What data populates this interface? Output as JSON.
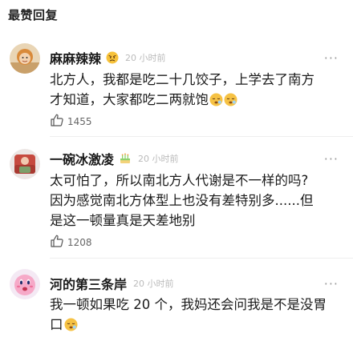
{
  "section": {
    "title": "最赞回复"
  },
  "comments": [
    {
      "username": "麻麻辣辣",
      "time": "20 小时前",
      "line1": "北方人，我都是吃二十几饺子，上学去了南方",
      "line2": "才知道，大家都吃二两就饱",
      "likes": "1455",
      "badge_icon": "angry-face-emoji",
      "trailing_emojis": [
        "sleepy-face-emoji",
        "sleepy-face-emoji"
      ]
    },
    {
      "username": "一碗冰激凌",
      "time": "20 小时前",
      "line1": "太可怕了，所以南北方人代谢是不一样的吗?",
      "line2": "因为感觉南北方体型上也没有差特别多......但",
      "line3": "是这一顿量真是天差地别",
      "likes": "1208",
      "badge_icon": "cake-emoji"
    },
    {
      "username": "河的第三条岸",
      "time": "20 小时前",
      "line1": "我一顿如果吃 20 个，我妈还会问我是不是没胃",
      "line2": "口",
      "trailing_emojis": [
        "sleepy-face-emoji"
      ]
    }
  ],
  "colors": {
    "username": "#1a1a1a",
    "timestamp": "#bbbbbb",
    "like_count": "#666666",
    "divider": "#eeeeee"
  }
}
